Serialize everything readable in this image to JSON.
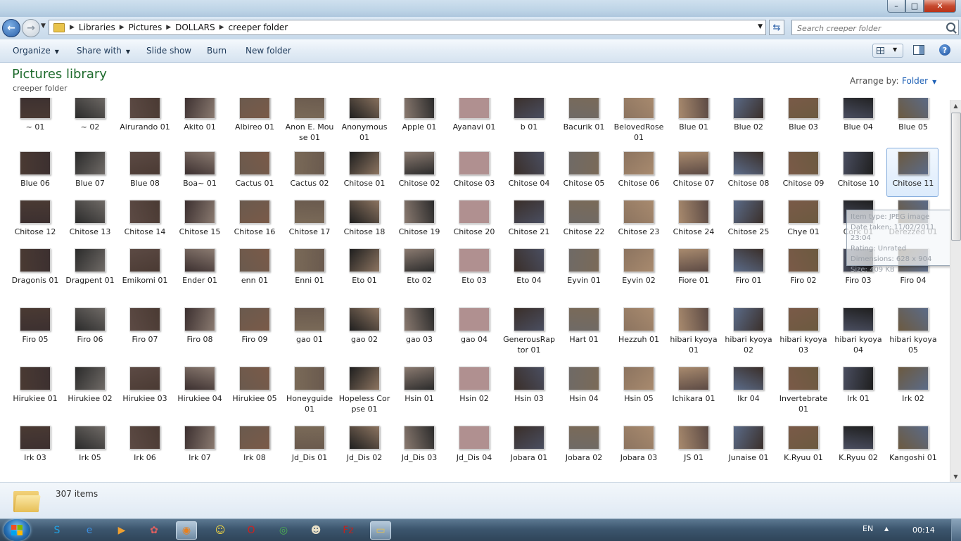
{
  "window": {
    "minimize_symbol": "–",
    "maximize_symbol": "□",
    "close_symbol": "✕"
  },
  "nav": {
    "back_symbol": "←",
    "forward_symbol": "→",
    "breadcrumbs": [
      "Libraries",
      "Pictures",
      "DOLLARS",
      "creeper folder"
    ],
    "search_placeholder": "Search creeper folder"
  },
  "toolbar": {
    "organize": "Organize",
    "share_with": "Share with",
    "slide_show": "Slide show",
    "burn": "Burn",
    "new_folder": "New folder",
    "help": "?"
  },
  "library": {
    "title": "Pictures library",
    "subtitle": "creeper folder",
    "arrange_label": "Arrange by:",
    "arrange_value": "Folder"
  },
  "tooltip": {
    "lines": [
      "Item type: JPEG image",
      "Date taken: 11/02/2011 23:04",
      "Rating: Unrated",
      "Dimensions: 628 x 904",
      "Size: 409 KB"
    ]
  },
  "selected_item": "Chitose 11",
  "files": [
    "~ 01",
    "~ 02",
    "Airurando 01",
    "Akito 01",
    "Albireo 01",
    "Anon E. Mouse 01",
    "Anonymous 01",
    "Apple 01",
    "Ayanavi 01",
    "b 01",
    "Bacurik 01",
    "BelovedRose 01",
    "Blue 01",
    "Blue 02",
    "Blue 03",
    "Blue 04",
    "Blue 05",
    "Blue 06",
    "Blue 07",
    "Blue 08",
    "Boa~ 01",
    "Cactus 01",
    "Cactus 02",
    "Chitose 01",
    "Chitose 02",
    "Chitose 03",
    "Chitose 04",
    "Chitose 05",
    "Chitose 06",
    "Chitose 07",
    "Chitose 08",
    "Chitose 09",
    "Chitose 10",
    "Chitose 11",
    "Chitose 12",
    "Chitose 13",
    "Chitose 14",
    "Chitose 15",
    "Chitose 16",
    "Chitose 17",
    "Chitose 18",
    "Chitose 19",
    "Chitose 20",
    "Chitose 21",
    "Chitose 22",
    "Chitose 23",
    "Chitose 24",
    "Chitose 25",
    "Chye 01",
    "Cork 01",
    "Derezzed 01",
    "Dragonis 01",
    "Dragpent 01",
    "Emikomi 01",
    "Ender 01",
    "enn 01",
    "Enni 01",
    "Eto 01",
    "Eto 02",
    "Eto 03",
    "Eto 04",
    "Eyvin 01",
    "Eyvin 02",
    "Fiore 01",
    "Firo 01",
    "Firo 02",
    "Firo 03",
    "Firo 04",
    "Firo 05",
    "Firo 06",
    "Firo 07",
    "Firo 08",
    "Firo 09",
    "gao 01",
    "gao 02",
    "gao 03",
    "gao 04",
    "GenerousRaptor 01",
    "Hart 01",
    "Hezzuh 01",
    "hibari kyoya 01",
    "hibari kyoya 02",
    "hibari kyoya 03",
    "hibari kyoya 04",
    "hibari kyoya 05",
    "Hirukiee 01",
    "Hirukiee 02",
    "Hirukiee 03",
    "Hirukiee 04",
    "Hirukiee 05",
    "Honeyguide 01",
    "Hopeless Corpse 01",
    "Hsin 01",
    "Hsin 02",
    "Hsin 03",
    "Hsin 04",
    "Hsin 05",
    "Ichikara 01",
    "Ikr 04",
    "Invertebrate 01",
    "Irk 01",
    "Irk 02",
    "Irk 03",
    "Irk 05",
    "Irk 06",
    "Irk 07",
    "Irk 08",
    "Jd_Dis 01",
    "Jd_Dis 02",
    "Jd_Dis 03",
    "Jd_Dis 04",
    "Jobara 01",
    "Jobara 02",
    "Jobara 03",
    "JS 01",
    "Junaise 01",
    "K.Ryuu 01",
    "K.Ryuu 02",
    "Kangoshi 01"
  ],
  "thumb_colors": [
    "#4a3a33",
    "#2b2b2b",
    "#5c4a44",
    "#3c3030",
    "#6a5a4e",
    "#7a6a58",
    "#1f1f1f",
    "#8a7a70",
    "#b09090",
    "#3a2f2a",
    "#6f6a66",
    "#8c7460",
    "#a88a6e",
    "#5b6b88",
    "#7a5a48",
    "#4a4e60",
    "#6c5a40"
  ],
  "status": {
    "item_count": "307 items"
  },
  "taskbar": {
    "language": "EN",
    "tray_symbol": "▲",
    "clock": "00:14",
    "apps": [
      {
        "name": "skype-icon",
        "symbol": "S",
        "color": "#21a0e0"
      },
      {
        "name": "internet-explorer-icon",
        "symbol": "e",
        "color": "#3c8fe0"
      },
      {
        "name": "media-player-icon",
        "symbol": "▶",
        "color": "#f0a030"
      },
      {
        "name": "paint-icon",
        "symbol": "✿",
        "color": "#e06060"
      },
      {
        "name": "firefox-icon",
        "symbol": "◉",
        "color": "#e8801e"
      },
      {
        "name": "messenger-icon",
        "symbol": "☺",
        "color": "#f2d640"
      },
      {
        "name": "opera-icon",
        "symbol": "O",
        "color": "#d0201e"
      },
      {
        "name": "chrome-icon",
        "symbol": "◎",
        "color": "#4caf50"
      },
      {
        "name": "game-icon",
        "symbol": "☻",
        "color": "#e8e0c8"
      },
      {
        "name": "filezilla-icon",
        "symbol": "Fz",
        "color": "#c0221e"
      },
      {
        "name": "explorer-icon",
        "symbol": "▭",
        "color": "#e9c34a"
      }
    ]
  }
}
